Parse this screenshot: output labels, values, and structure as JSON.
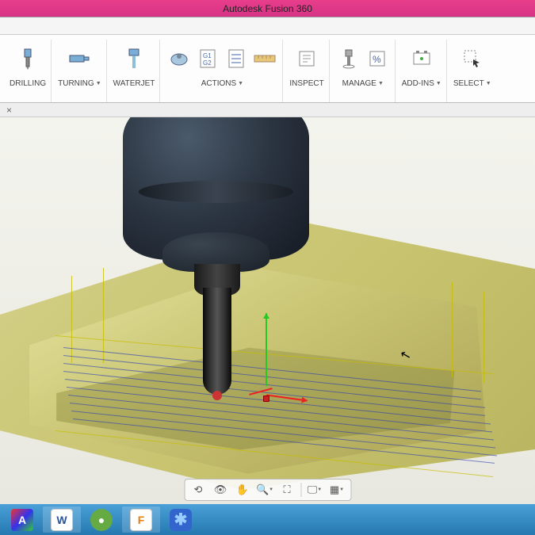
{
  "app": {
    "title": "Autodesk Fusion 360"
  },
  "ribbon": {
    "drilling": "DRILLING",
    "turning": "TURNING",
    "waterjet": "WATERJET",
    "actions": "ACTIONS",
    "inspect": "INSPECT",
    "manage": "MANAGE",
    "addins": "ADD-INS",
    "select": "SELECT"
  },
  "nav": {
    "orbit": "⟲",
    "look": "👁",
    "pan": "✋",
    "zoom": "🔍",
    "fit": "⛶",
    "display": "🖵",
    "grid": "▦"
  },
  "taskbar": {
    "app1": "A",
    "word": "W",
    "green": "●",
    "fusion": "F",
    "meet": "✱"
  }
}
